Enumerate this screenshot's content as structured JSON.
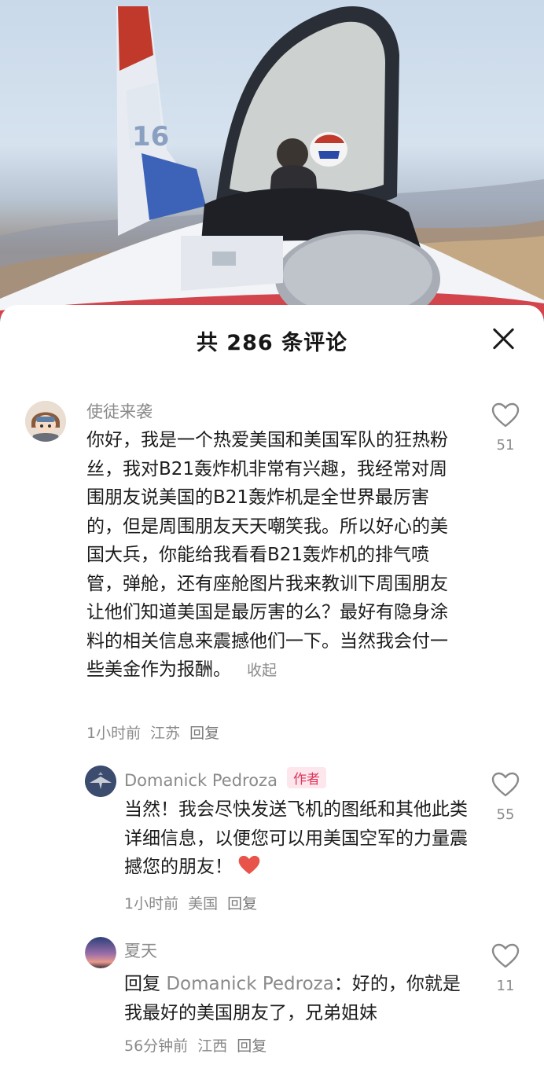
{
  "sheet": {
    "title": "共 286 条评论"
  },
  "comments": [
    {
      "username": "使徒来袭",
      "text": "你好，我是一个热爱美国和美国军队的狂热粉丝，我对B21轰炸机非常有兴趣，我经常对周围朋友说美国的B21轰炸机是全世界最厉害的，但是周围朋友天天嘲笑我。所以好心的美国大兵，你能给我看看B21轰炸机的排气喷管，弹舱，还有座舱图片我来教训下周围朋友让他们知道美国是最厉害的么？最好有隐身涂料的相关信息来震撼他们一下。当然我会付一些美金作为报酬。",
      "collapse_label": "收起",
      "time": "1小时前",
      "location": "江苏",
      "reply_label": "回复",
      "likes": "51"
    }
  ],
  "replies": [
    {
      "username": "Domanick Pedroza",
      "badge": "作者",
      "text": "当然！我会尽快发送飞机的图纸和其他此类详细信息，以便您可以用美国空军的力量震撼您的朋友！",
      "time": "1小时前",
      "location": "美国",
      "reply_label": "回复",
      "likes": "55"
    },
    {
      "username": "夏天",
      "reply_prefix": "回复",
      "reply_to": "Domanick Pedroza",
      "text": "：好的，你就是我最好的美国朋友了，兄弟姐妹",
      "time": "56分钟前",
      "location": "江西",
      "reply_label": "回复",
      "likes": "11"
    }
  ],
  "colors": {
    "badge_text": "#e0345b",
    "badge_bg": "#fde7ec",
    "heart_emoji": "#e8534a"
  },
  "icons": [
    "heart-outline-icon",
    "close-icon",
    "red-heart-emoji-icon"
  ]
}
